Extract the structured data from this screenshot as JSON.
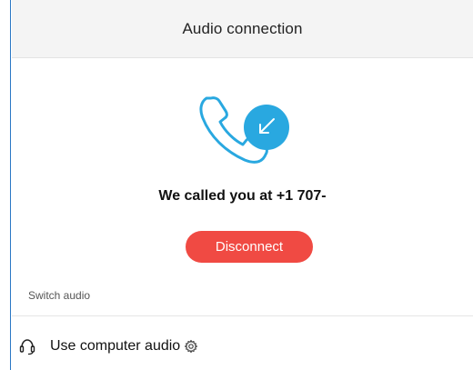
{
  "dialog": {
    "title": "Audio connection"
  },
  "call": {
    "status_text": "We called you at +1 707-",
    "disconnect_label": "Disconnect",
    "icon": "phone-incoming-icon"
  },
  "switch_audio": {
    "section_label": "Switch audio",
    "option_label": "Use computer audio",
    "option_icon": "headset-icon",
    "settings_icon": "gear-icon"
  },
  "colors": {
    "accent_blue": "#29a8e0",
    "disconnect_red": "#f04a43",
    "window_border": "#2b78c5"
  }
}
